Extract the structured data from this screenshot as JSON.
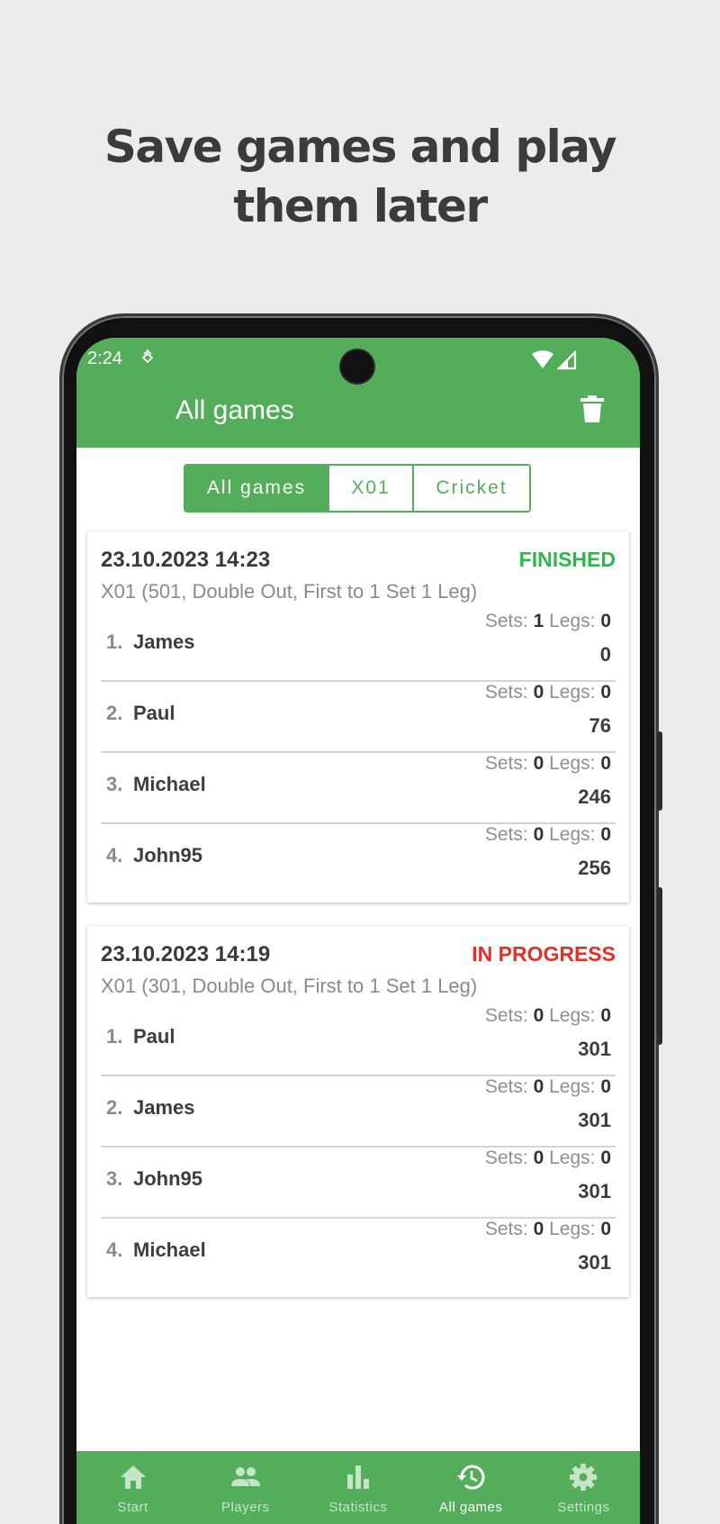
{
  "headline": "Save games and play them later",
  "status_bar": {
    "time": "2:24"
  },
  "app_bar": {
    "title": "All games"
  },
  "filter_tabs": [
    {
      "label": "All games",
      "active": true
    },
    {
      "label": "X01",
      "active": false
    },
    {
      "label": "Cricket",
      "active": false
    }
  ],
  "games": [
    {
      "date": "23.10.2023 14:23",
      "status": "FINISHED",
      "status_color": "#2db84c",
      "description": "X01 (501, Double Out, First to 1 Set 1 Leg)",
      "players": [
        {
          "rank": "1.",
          "name": "James",
          "sets_label": "Sets:",
          "sets": "1",
          "legs_label": "Legs:",
          "legs": "0",
          "score": "0"
        },
        {
          "rank": "2.",
          "name": "Paul",
          "sets_label": "Sets:",
          "sets": "0",
          "legs_label": "Legs:",
          "legs": "0",
          "score": "76"
        },
        {
          "rank": "3.",
          "name": "Michael",
          "sets_label": "Sets:",
          "sets": "0",
          "legs_label": "Legs:",
          "legs": "0",
          "score": "246"
        },
        {
          "rank": "4.",
          "name": "John95",
          "sets_label": "Sets:",
          "sets": "0",
          "legs_label": "Legs:",
          "legs": "0",
          "score": "256"
        }
      ]
    },
    {
      "date": "23.10.2023 14:19",
      "status": "IN PROGRESS",
      "status_color": "#e52e24",
      "description": "X01 (301, Double Out, First to 1 Set 1 Leg)",
      "players": [
        {
          "rank": "1.",
          "name": "Paul",
          "sets_label": "Sets:",
          "sets": "0",
          "legs_label": "Legs:",
          "legs": "0",
          "score": "301"
        },
        {
          "rank": "2.",
          "name": "James",
          "sets_label": "Sets:",
          "sets": "0",
          "legs_label": "Legs:",
          "legs": "0",
          "score": "301"
        },
        {
          "rank": "3.",
          "name": "John95",
          "sets_label": "Sets:",
          "sets": "0",
          "legs_label": "Legs:",
          "legs": "0",
          "score": "301"
        },
        {
          "rank": "4.",
          "name": "Michael",
          "sets_label": "Sets:",
          "sets": "0",
          "legs_label": "Legs:",
          "legs": "0",
          "score": "301"
        }
      ]
    }
  ],
  "bottom_nav": [
    {
      "label": "Start",
      "icon": "home-icon",
      "active": false
    },
    {
      "label": "Players",
      "icon": "people-icon",
      "active": false
    },
    {
      "label": "Statistics",
      "icon": "bar-chart-icon",
      "active": false
    },
    {
      "label": "All games",
      "icon": "history-icon",
      "active": true
    },
    {
      "label": "Settings",
      "icon": "gear-icon",
      "active": false
    }
  ],
  "colors": {
    "primary": "#53ad5a",
    "background": "#ececec",
    "finished": "#2db84c",
    "in_progress": "#e52e24"
  }
}
